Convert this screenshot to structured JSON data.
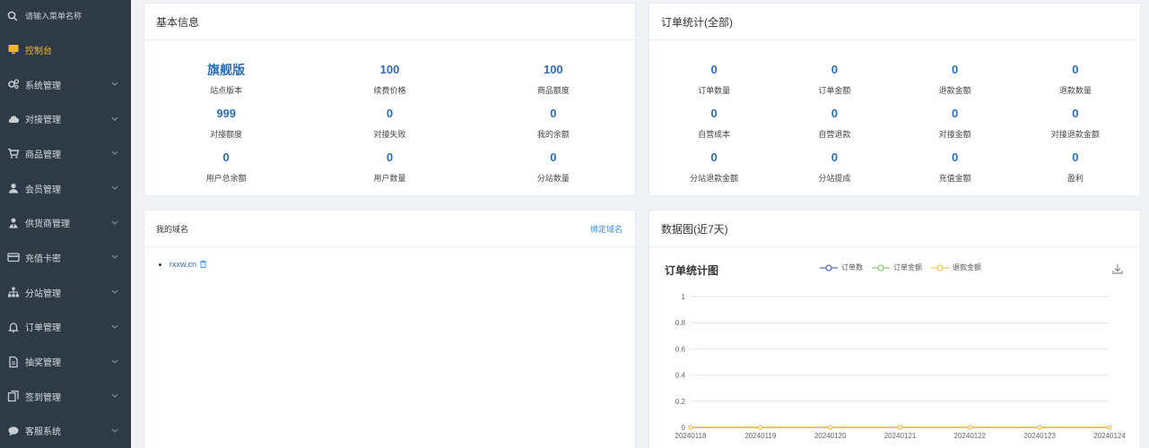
{
  "sidebar": {
    "search_placeholder": "请输入菜单名称",
    "items": [
      {
        "label": "控制台",
        "icon": "monitor-icon",
        "active": true
      },
      {
        "label": "系统管理",
        "icon": "gears-icon"
      },
      {
        "label": "对接管理",
        "icon": "cloud-icon"
      },
      {
        "label": "商品管理",
        "icon": "cart-icon"
      },
      {
        "label": "会员管理",
        "icon": "user-icon"
      },
      {
        "label": "供货商管理",
        "icon": "supplier-icon"
      },
      {
        "label": "充值卡密",
        "icon": "card-icon"
      },
      {
        "label": "分站管理",
        "icon": "sitemap-icon"
      },
      {
        "label": "订单管理",
        "icon": "bell-icon"
      },
      {
        "label": "抽奖管理",
        "icon": "file-icon"
      },
      {
        "label": "签到管理",
        "icon": "copy-icon"
      },
      {
        "label": "客服系统",
        "icon": "chat-icon"
      }
    ]
  },
  "basic_info": {
    "title": "基本信息",
    "stats": [
      {
        "value": "旗舰版",
        "label": "站点版本"
      },
      {
        "value": "100",
        "label": "续费价格"
      },
      {
        "value": "100",
        "label": "商品额度"
      },
      {
        "value": "999",
        "label": "对接额度"
      },
      {
        "value": "0",
        "label": "对接失败"
      },
      {
        "value": "0",
        "label": "我的余额"
      },
      {
        "value": "0",
        "label": "用户总余额"
      },
      {
        "value": "0",
        "label": "用户数量"
      },
      {
        "value": "0",
        "label": "分站数量"
      }
    ]
  },
  "order_stats": {
    "title": "订单统计(全部)",
    "stats": [
      {
        "value": "0",
        "label": "订单数量"
      },
      {
        "value": "0",
        "label": "订单金额"
      },
      {
        "value": "0",
        "label": "退款金额"
      },
      {
        "value": "0",
        "label": "退款数量"
      },
      {
        "value": "0",
        "label": "自营成本"
      },
      {
        "value": "0",
        "label": "自营退款"
      },
      {
        "value": "0",
        "label": "对接金额"
      },
      {
        "value": "0",
        "label": "对接退款金额"
      },
      {
        "value": "0",
        "label": "分站退款金额"
      },
      {
        "value": "0",
        "label": "分站提成"
      },
      {
        "value": "0",
        "label": "充值金额"
      },
      {
        "value": "0",
        "label": "盈利"
      }
    ]
  },
  "domains": {
    "title": "我的域名",
    "bind_label": "绑定域名",
    "items": [
      "rxxw.cn"
    ]
  },
  "data_chart": {
    "title": "数据图(近7天)"
  },
  "chart_data": {
    "type": "line",
    "title": "订单统计图",
    "x": [
      "20240118",
      "20240119",
      "20240120",
      "20240121",
      "20240122",
      "20240123",
      "20240124"
    ],
    "series": [
      {
        "name": "订单数",
        "values": [
          0,
          0,
          0,
          0,
          0,
          0,
          0
        ],
        "color": "#5470c6"
      },
      {
        "name": "订单金额",
        "values": [
          0,
          0,
          0,
          0,
          0,
          0,
          0
        ],
        "color": "#91cc75"
      },
      {
        "name": "退款金额",
        "values": [
          0,
          0,
          0,
          0,
          0,
          0,
          0
        ],
        "color": "#fac858"
      }
    ],
    "ylim": [
      0,
      1
    ],
    "yticks": [
      "0",
      "0.2",
      "0.4",
      "0.6",
      "0.8",
      "1"
    ],
    "grid": true,
    "legend": "top"
  }
}
